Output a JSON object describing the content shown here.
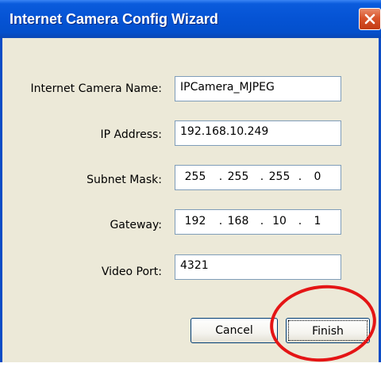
{
  "window": {
    "title": "Internet Camera Config Wizard",
    "close_icon": "close-icon"
  },
  "form": {
    "camera_name": {
      "label": "Internet Camera Name:",
      "value": "IPCamera_MJPEG"
    },
    "ip_address": {
      "label": "IP Address:",
      "value": "192.168.10.249"
    },
    "subnet_mask": {
      "label": "Subnet Mask:",
      "octets": [
        "255",
        "255",
        "255",
        "0"
      ]
    },
    "gateway": {
      "label": "Gateway:",
      "octets": [
        "192",
        "168",
        "10",
        "1"
      ]
    },
    "video_port": {
      "label": "Video Port:",
      "value": "4321"
    }
  },
  "buttons": {
    "cancel": "Cancel",
    "finish": "Finish"
  },
  "colors": {
    "titlebar": "#0553d4",
    "dialog_bg": "#ece9d8",
    "highlight_ring": "#e41515"
  }
}
